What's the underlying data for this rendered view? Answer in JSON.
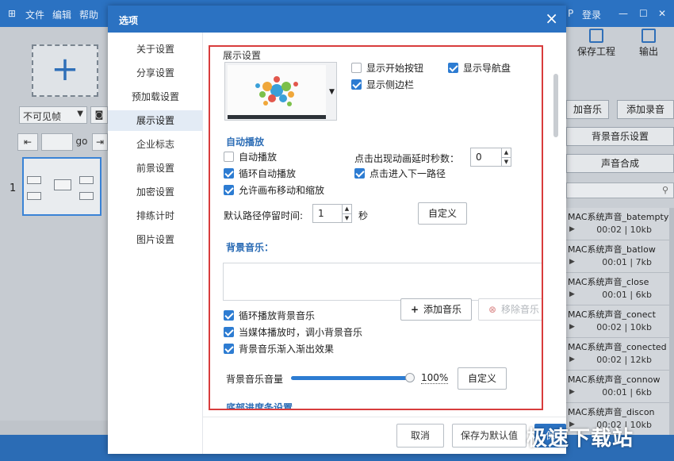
{
  "app": {
    "menu": [
      "文件",
      "编辑",
      "帮助"
    ],
    "login_label": "登录",
    "left": {
      "select_value": "不可见帧",
      "nav_go": "go",
      "slide_number": "1"
    },
    "right": {
      "save_project": "保存工程",
      "export": "输出",
      "add_music": "加音乐",
      "add_record": "添加录音",
      "bg_music_settings": "背景音乐设置",
      "sound_compose": "声音合成",
      "sounds": [
        {
          "name": "MAC系统声音_batempty",
          "meta": "00:02 | 10kb"
        },
        {
          "name": "MAC系统声音_batlow",
          "meta": "00:01 | 7kb"
        },
        {
          "name": "MAC系统声音_close",
          "meta": "00:01 | 6kb"
        },
        {
          "name": "MAC系统声音_conect",
          "meta": "00:02 | 10kb"
        },
        {
          "name": "MAC系统声音_conected",
          "meta": "00:02 | 12kb"
        },
        {
          "name": "MAC系统声音_connow",
          "meta": "00:01 | 6kb"
        },
        {
          "name": "MAC系统声音_discon",
          "meta": "00:02 | 10kb"
        }
      ]
    }
  },
  "dialog": {
    "title": "选项",
    "close_symbol": "×",
    "nav": [
      {
        "label": "关于设置"
      },
      {
        "label": "分享设置"
      },
      {
        "label": "预加载设置"
      },
      {
        "label": "展示设置",
        "active": true
      },
      {
        "label": "企业标志"
      },
      {
        "label": "前景设置"
      },
      {
        "label": "加密设置"
      },
      {
        "label": "排练计时"
      },
      {
        "label": "图片设置"
      }
    ],
    "display": {
      "heading": "展示设置",
      "show_start_button": {
        "label": "显示开始按钮",
        "checked": false
      },
      "show_nav_disk": {
        "label": "显示导航盘",
        "checked": true
      },
      "show_sidebar": {
        "label": "显示侧边栏",
        "checked": true
      }
    },
    "autoplay": {
      "heading": "自动播放",
      "autoplay": {
        "label": "自动播放",
        "checked": false
      },
      "loop_autoplay": {
        "label": "循环自动播放",
        "checked": true
      },
      "allow_canvas": {
        "label": "允许画布移动和缩放",
        "checked": true
      },
      "delay_label": "点击出现动画延时秒数：",
      "delay_value": "0",
      "click_next": {
        "label": "点击进入下一路径",
        "checked": true
      },
      "path_stay_label": "默认路径停留时间:",
      "path_stay_value": "1",
      "path_stay_unit": "秒",
      "custom_label": "自定义"
    },
    "bg_music": {
      "heading": "背景音乐：",
      "loop": {
        "label": "循环播放背景音乐",
        "checked": true
      },
      "duck": {
        "label": "当媒体播放时，调小背景音乐",
        "checked": true
      },
      "fade": {
        "label": "背景音乐渐入渐出效果",
        "checked": true
      },
      "add_music": "添加音乐",
      "remove_music": "移除音乐",
      "volume_label": "背景音乐音量",
      "volume_value": "100%",
      "volume_fraction": 1.0,
      "custom_label": "自定义"
    },
    "progress_heading": "底部进度条设置",
    "footer": {
      "cancel": "取消",
      "save_default": "保存为默认值",
      "ok": "保"
    }
  },
  "watermark": "极速下载站"
}
